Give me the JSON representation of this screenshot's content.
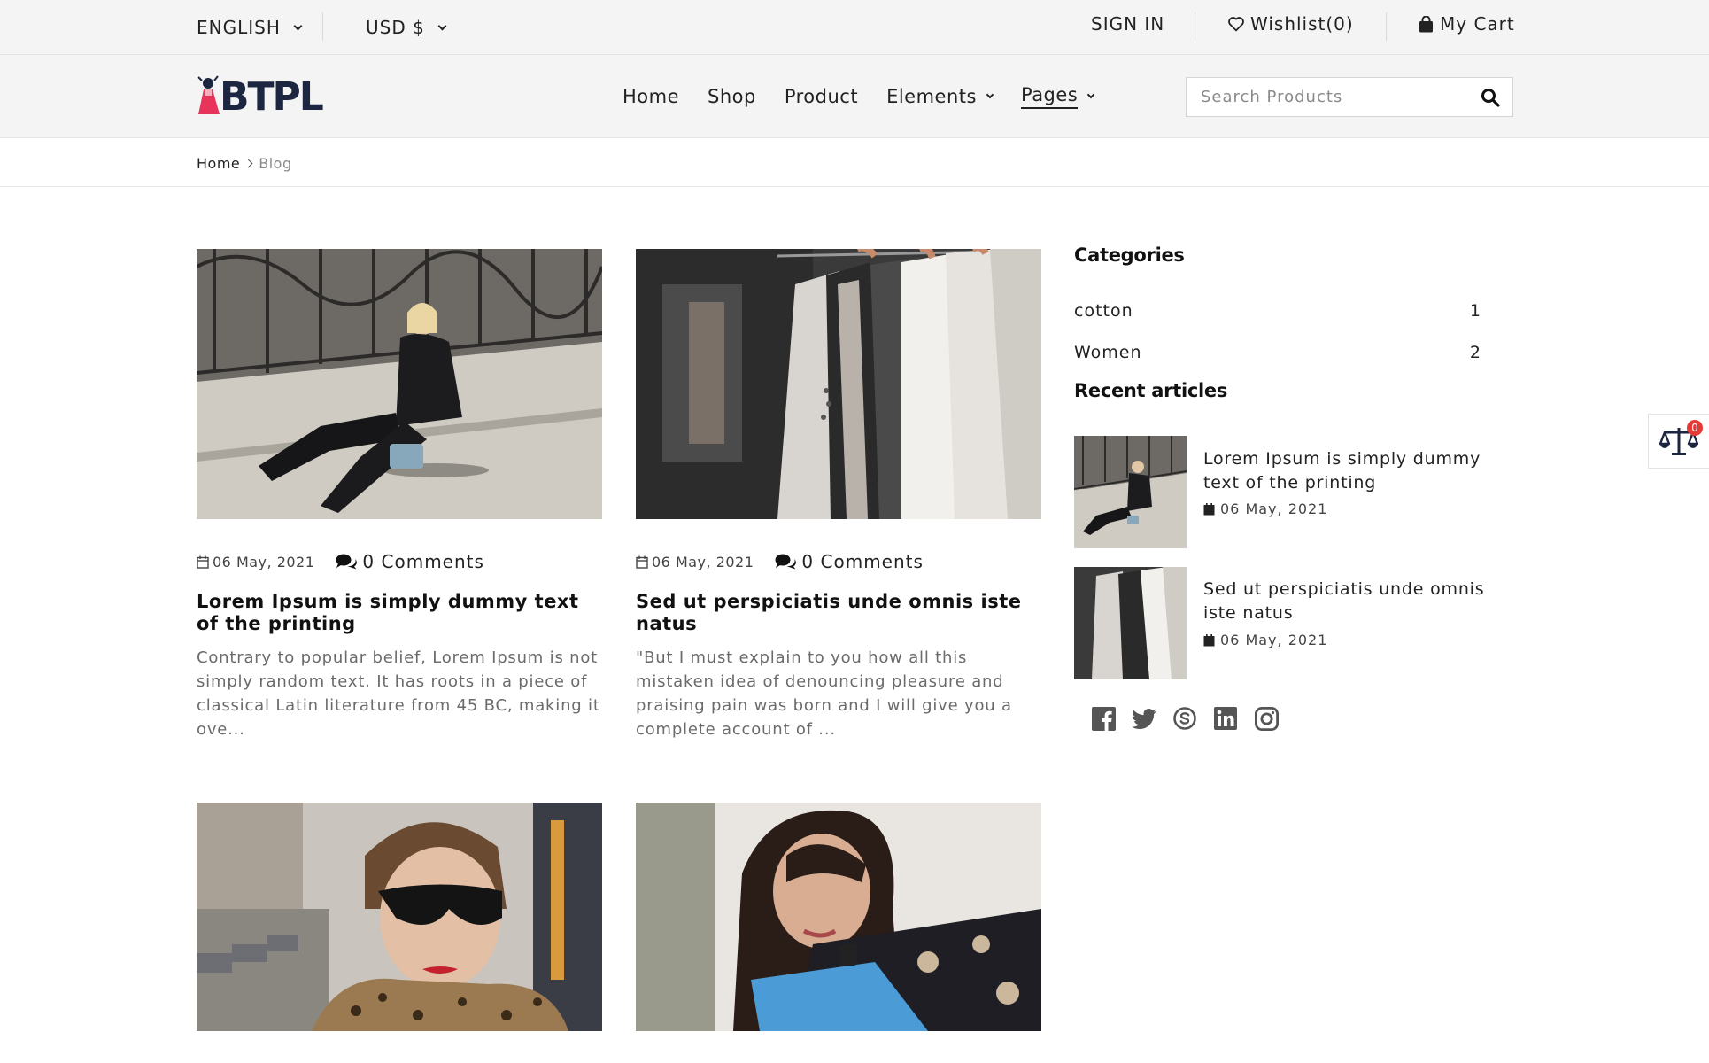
{
  "topbar": {
    "language": "ENGLISH",
    "currency": "USD $",
    "sign_in": "SIGN IN",
    "wishlist": "Wishlist(0)",
    "cart": "My Cart"
  },
  "header": {
    "logo": "BTPL",
    "nav": [
      "Home",
      "Shop",
      "Product",
      "Elements",
      "Pages"
    ],
    "search_placeholder": "Search Products"
  },
  "breadcrumb": {
    "home": "Home",
    "current": "Blog"
  },
  "posts": [
    {
      "date": "06 May, 2021",
      "comments": "0 Comments",
      "title": "Lorem Ipsum is simply dummy text of the printing",
      "excerpt": "Contrary to popular belief, Lorem Ipsum is not simply random text. It has roots in a piece of classical Latin literature from 45 BC, making it ove..."
    },
    {
      "date": "06 May, 2021",
      "comments": "0 Comments",
      "title": "Sed ut perspiciatis unde omnis iste natus",
      "excerpt": "\"But I must explain to you how all this mistaken idea of denouncing pleasure and praising pain was born and I will give you a complete account of ..."
    }
  ],
  "sidebar": {
    "categories_heading": "Categories",
    "categories": [
      {
        "name": "cotton",
        "count": "1"
      },
      {
        "name": "Women",
        "count": "2"
      }
    ],
    "recent_heading": "Recent articles",
    "recent": [
      {
        "title": "Lorem Ipsum is simply dummy text of the printing",
        "date": "06 May, 2021"
      },
      {
        "title": "Sed ut perspiciatis unde omnis iste natus",
        "date": "06 May, 2021"
      }
    ],
    "social": [
      "facebook-icon",
      "twitter-icon",
      "skype-icon",
      "linkedin-icon",
      "instagram-icon"
    ]
  },
  "compare_count": "0",
  "colors": {
    "accent_red": "#e53935",
    "logo_navy": "#1d2640",
    "bar_bg": "#f4f4f4"
  }
}
